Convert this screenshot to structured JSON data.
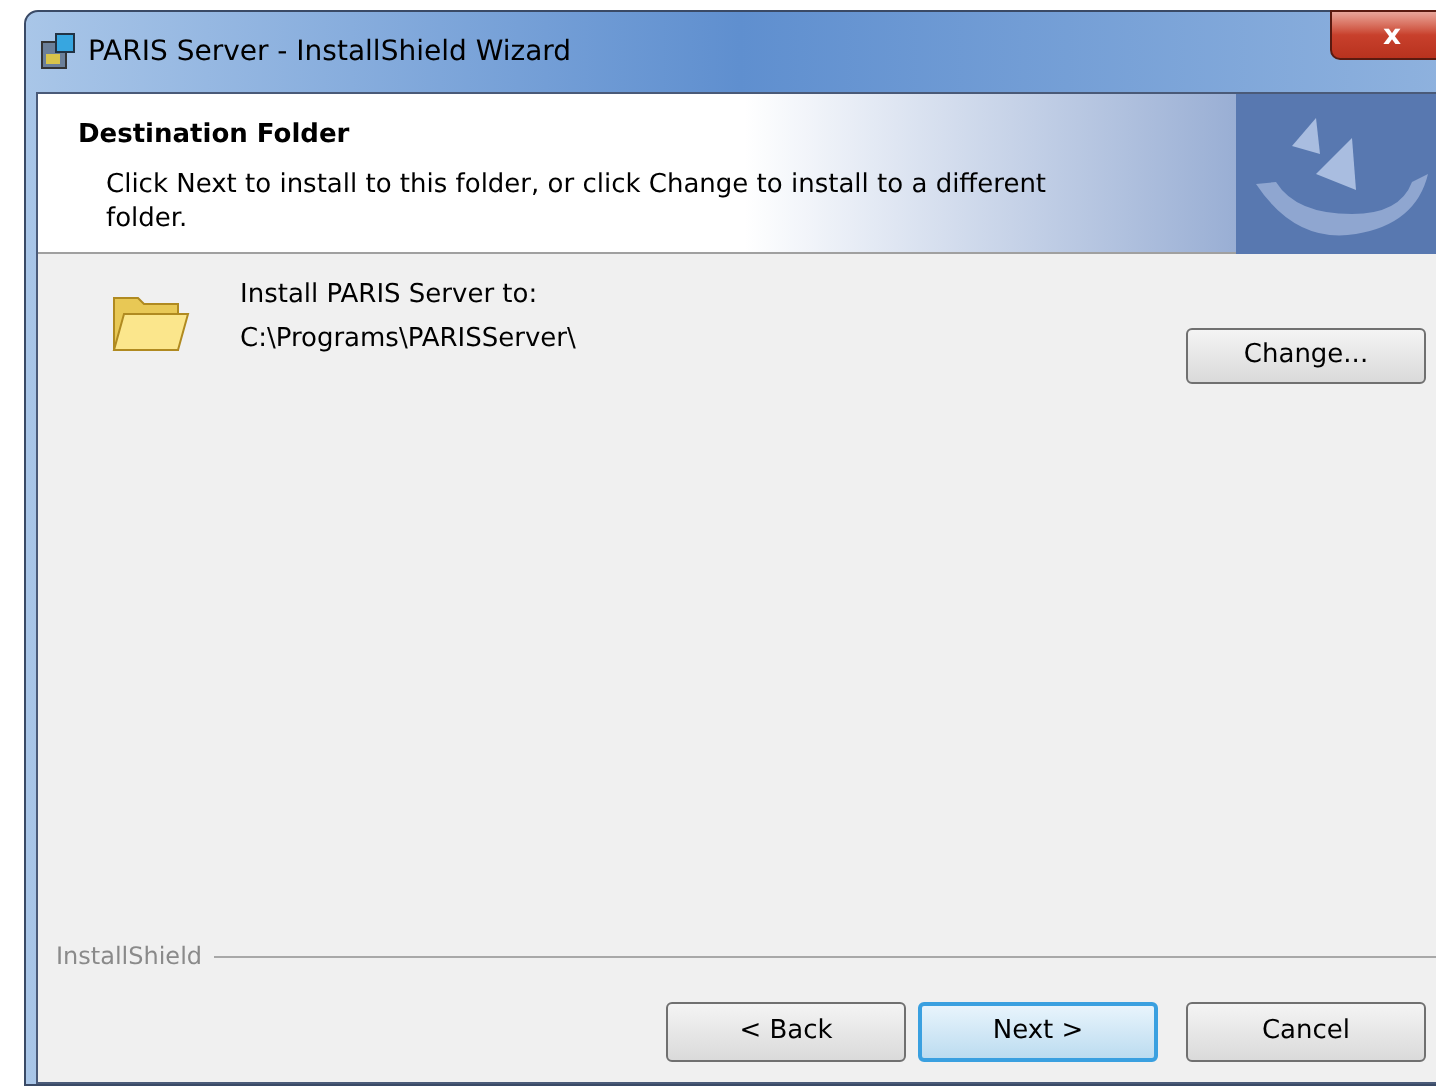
{
  "window": {
    "title": "PARIS Server - InstallShield Wizard",
    "close": "x"
  },
  "header": {
    "title": "Destination Folder",
    "description": "Click Next to install to this folder, or click Change to install to a different folder."
  },
  "destination": {
    "label": "Install PARIS Server to:",
    "path": "C:\\Programs\\PARISServer\\",
    "change_button": "Change..."
  },
  "footer": {
    "brand": "InstallShield"
  },
  "buttons": [
    {
      "label": "< Back",
      "default": false
    },
    {
      "label": "Next >",
      "default": true
    },
    {
      "label": "Cancel",
      "default": false
    }
  ]
}
